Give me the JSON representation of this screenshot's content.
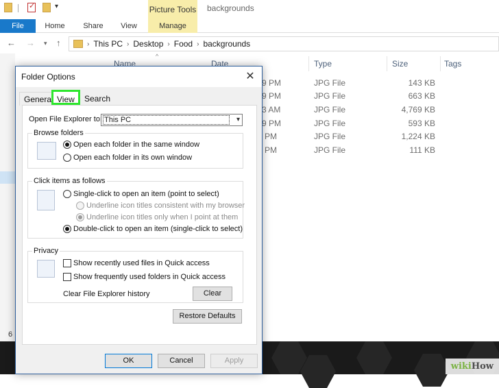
{
  "explorer": {
    "context_tab": "Picture Tools",
    "window_title": "backgrounds",
    "ribbon_tabs": {
      "file": "File",
      "home": "Home",
      "share": "Share",
      "view": "View",
      "manage": "Manage"
    },
    "breadcrumb": [
      "This PC",
      "Desktop",
      "Food",
      "backgrounds"
    ],
    "columns": {
      "name": "Name",
      "date": "Date",
      "type": "Type",
      "size": "Size",
      "tags": "Tags"
    },
    "files": [
      {
        "time": "9 PM",
        "type": "JPG File",
        "size": "143 KB"
      },
      {
        "time": "9 PM",
        "type": "JPG File",
        "size": "663 KB"
      },
      {
        "time": "3 AM",
        "type": "JPG File",
        "size": "4,769 KB"
      },
      {
        "time": "9 PM",
        "type": "JPG File",
        "size": "593 KB"
      },
      {
        "time": "PM",
        "type": "JPG File",
        "size": "1,224 KB"
      },
      {
        "time": "PM",
        "type": "JPG File",
        "size": "111 KB"
      }
    ],
    "item_count": "6"
  },
  "dialog": {
    "title": "Folder Options",
    "tabs": {
      "general": "General",
      "view": "View",
      "search": "Search"
    },
    "open_explorer_label": "Open File Explorer to:",
    "open_explorer_value": "This PC",
    "browse_folders": {
      "title": "Browse folders",
      "same_window": "Open each folder in the same window",
      "own_window": "Open each folder in its own window"
    },
    "click_items": {
      "title": "Click items as follows",
      "single_click": "Single-click to open an item (point to select)",
      "underline_consistent": "Underline icon titles consistent with my browser",
      "underline_point": "Underline icon titles only when I point at them",
      "double_click": "Double-click to open an item (single-click to select)"
    },
    "privacy": {
      "title": "Privacy",
      "recent_files": "Show recently used files in Quick access",
      "frequent_folders": "Show frequently used folders in Quick access",
      "clear_history_label": "Clear File Explorer history",
      "clear_button": "Clear"
    },
    "restore_defaults": "Restore Defaults",
    "ok": "OK",
    "cancel": "Cancel",
    "apply": "Apply"
  },
  "watermark": {
    "part1": "wiki",
    "part2": "How"
  },
  "colors": {
    "accent": "#1979ca",
    "context_tab": "#f8edaa",
    "highlight": "#2ee62e"
  }
}
